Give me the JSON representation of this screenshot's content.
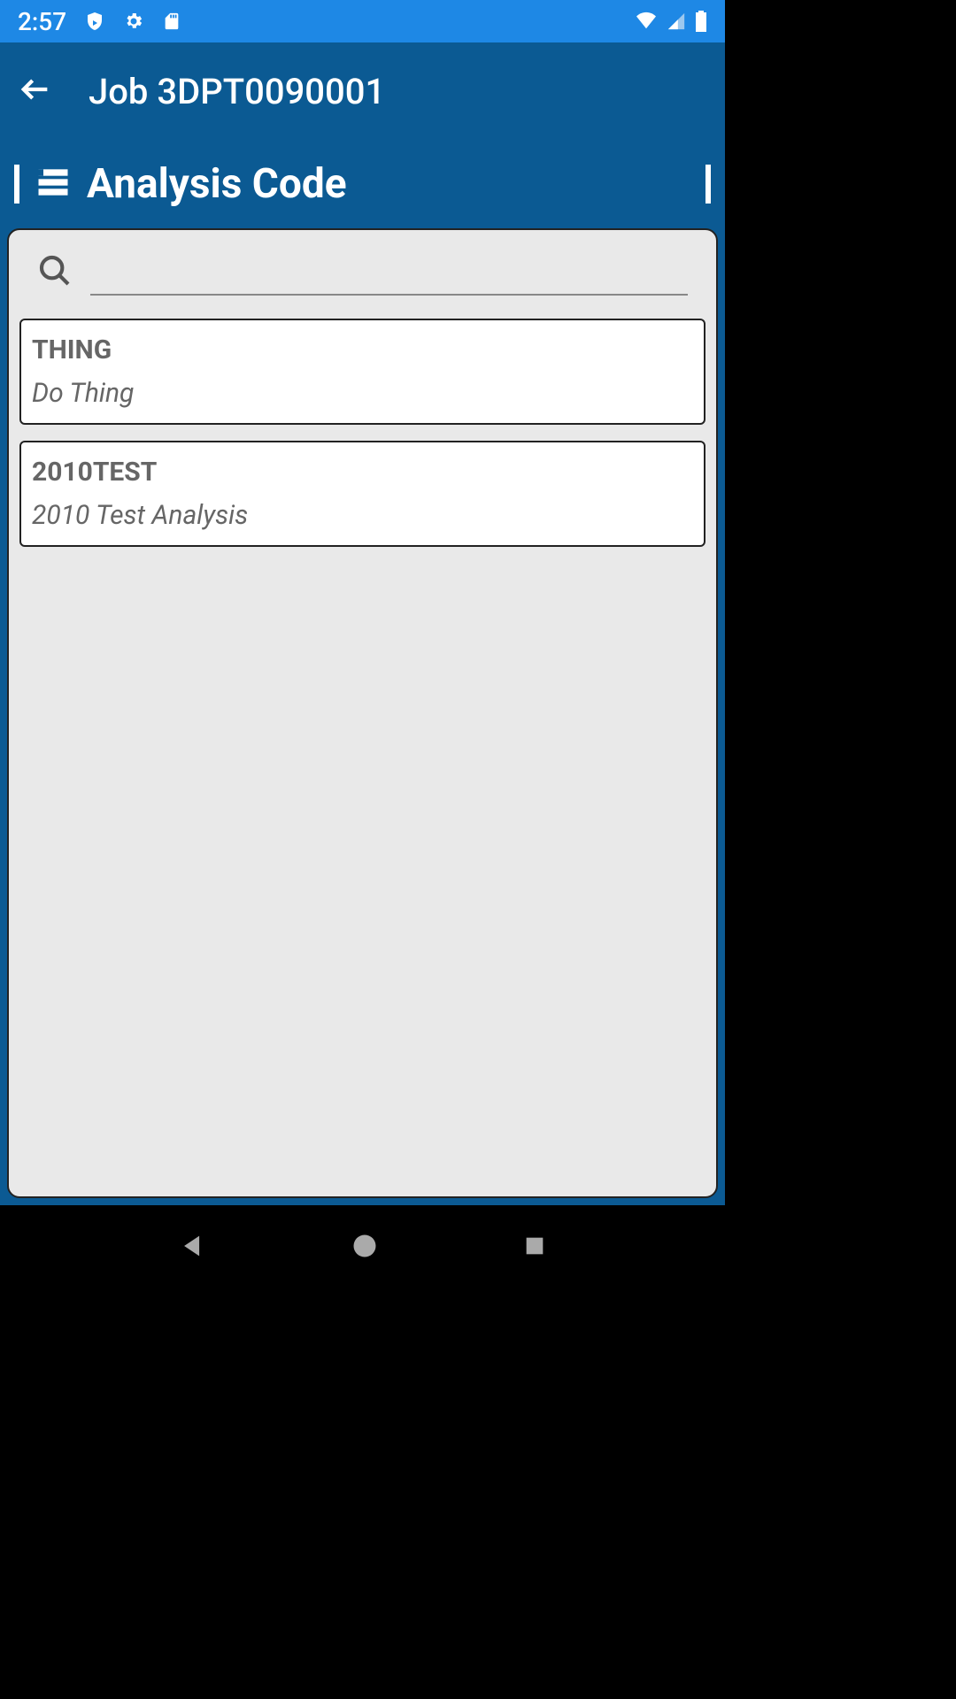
{
  "status": {
    "time": "2:57"
  },
  "appbar": {
    "title": "Job 3DPT0090001"
  },
  "section": {
    "title": "Analysis Code"
  },
  "search": {
    "value": "",
    "placeholder": ""
  },
  "items": [
    {
      "code": "THING",
      "desc": "Do Thing"
    },
    {
      "code": "2010TEST",
      "desc": "2010 Test Analysis"
    }
  ]
}
